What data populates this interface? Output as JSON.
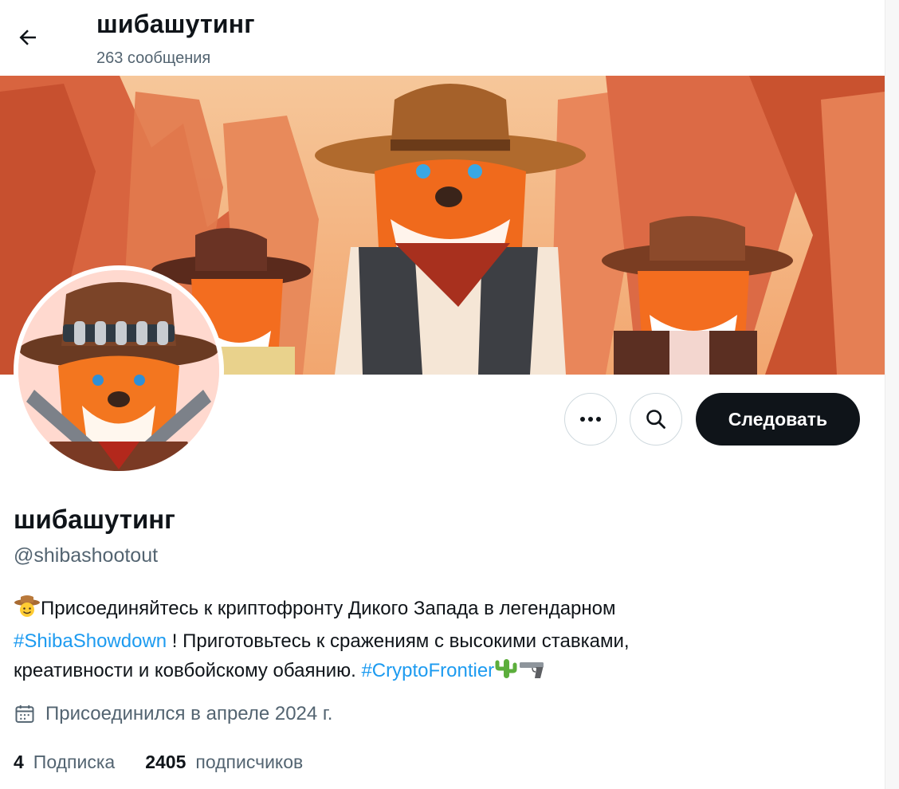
{
  "header": {
    "title": "шибашутинг",
    "post_count": "263 сообщения"
  },
  "actions": {
    "more_icon": "more-dots-icon",
    "search_icon": "search-icon",
    "follow_label": "Следовать"
  },
  "profile": {
    "display_name": "шибашутинг",
    "handle": "@shibashootout",
    "bio": {
      "part1": "Присоединяйтесь к криптофронту Дикого Запада в легендарном",
      "hashtag1": "#ShibaShowdown",
      "part2": " ! Приготовьтесь к сражениям с высокими ставками, креативности и ковбойскому обаянию. ",
      "hashtag2": "#CryptoFrontier",
      "emojis": [
        "cowboy-face",
        "cactus",
        "pistol"
      ]
    },
    "joined": "Присоединился в апреле 2024 г.",
    "following_count": "4",
    "following_label": "Подписка",
    "followers_count": "2405",
    "followers_label": "подписчиков"
  },
  "colors": {
    "accent": "#1d9bf0",
    "text": "#0f1419",
    "muted": "#536471",
    "follow_bg": "#0f1419"
  }
}
